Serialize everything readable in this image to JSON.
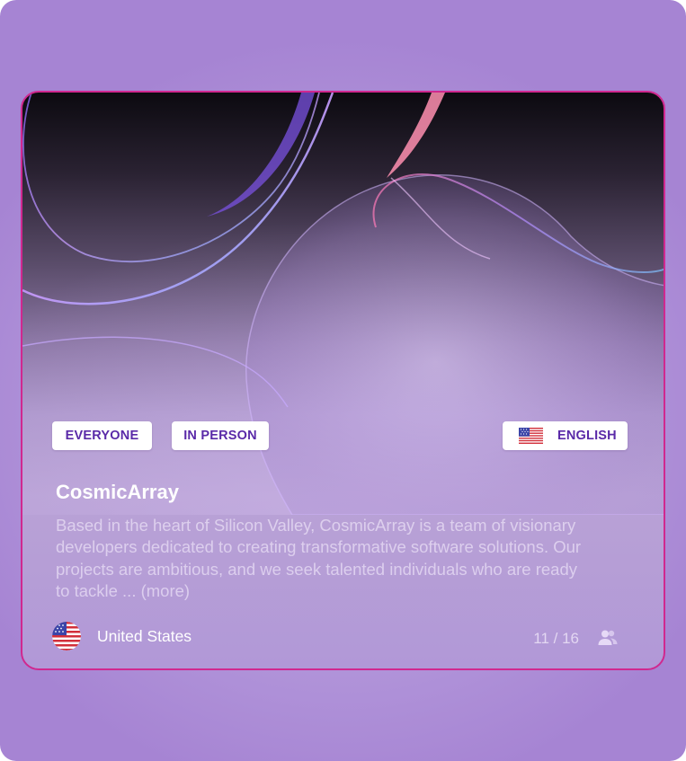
{
  "card": {
    "tags": [
      "EVERYONE",
      "IN PERSON"
    ],
    "language": "ENGLISH",
    "title": "CosmicArray",
    "description": "Based in the heart of Silicon Valley, CosmicArray is a team of visionary developers dedicated to creating transformative software solutions. Our projects are ambitious, and we seek talented individuals who are ready to tackle ... (more)",
    "country": "United States",
    "members": "11 / 16",
    "icons": {
      "language_flag": "us-flag-icon",
      "country_flag": "us-round-flag-icon",
      "members": "people-icon"
    },
    "colors": {
      "accent_border": "#d0288f",
      "chip_text": "#5a2aa8",
      "background": "#a684d3"
    }
  }
}
